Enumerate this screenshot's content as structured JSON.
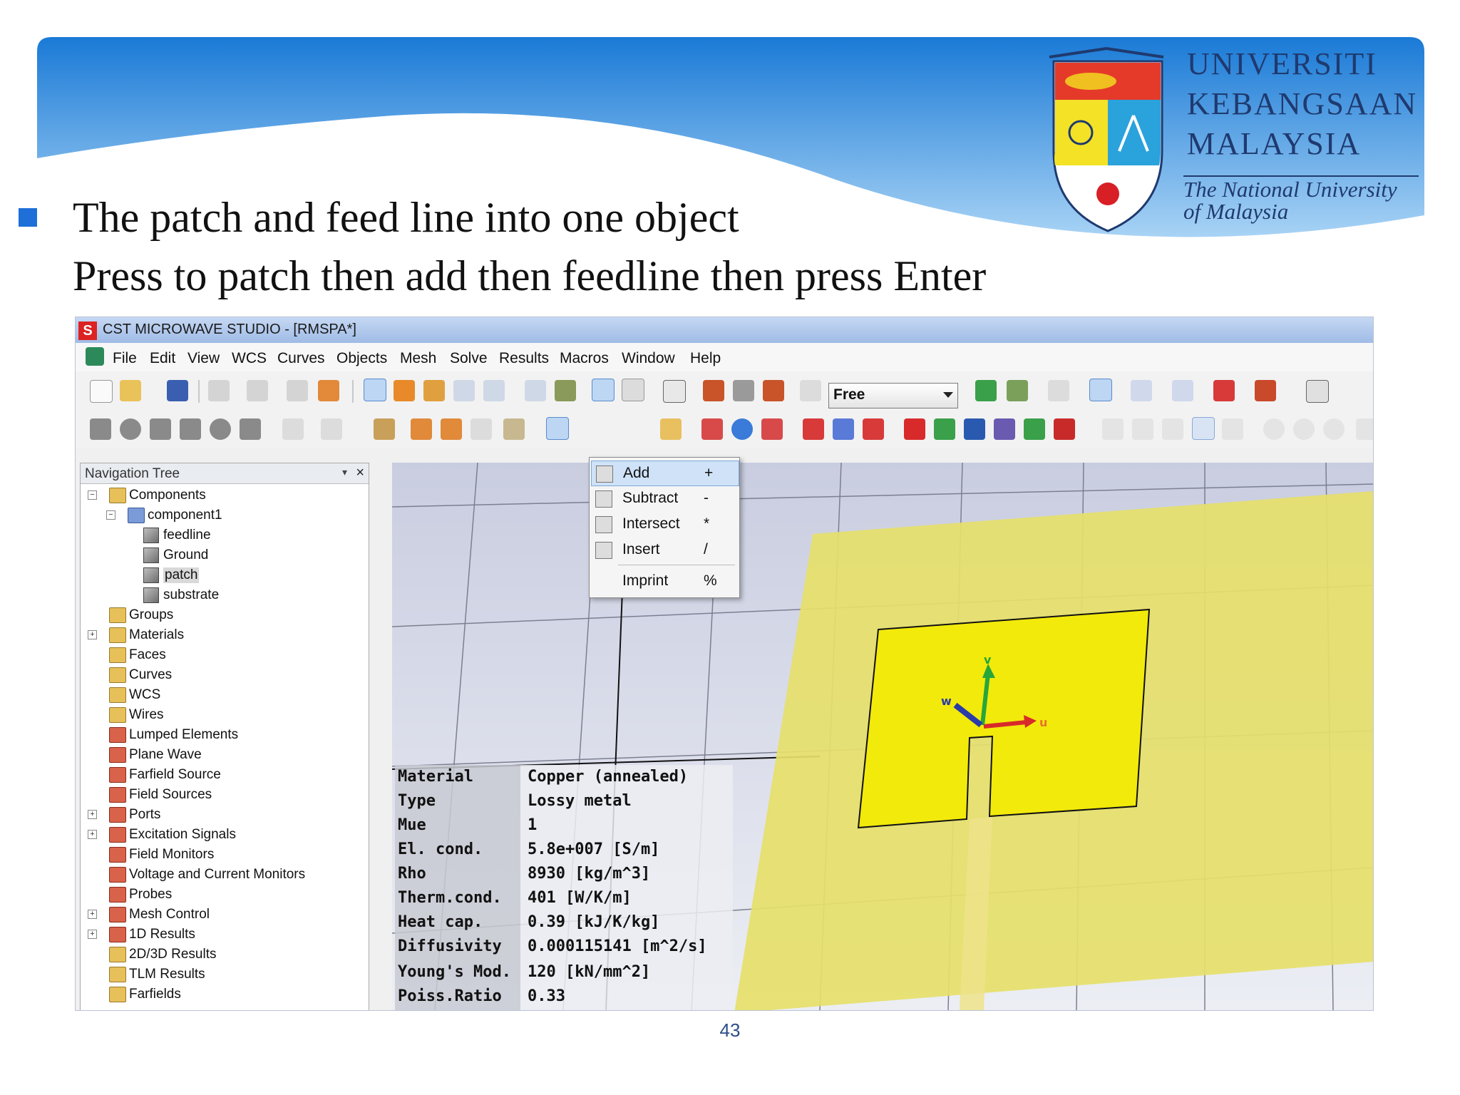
{
  "slide": {
    "line1": "The patch and feed line into one object",
    "line2": "Press to patch then add then feedline then press Enter",
    "page_number": "43"
  },
  "university": {
    "name_line1": "UNIVERSITI",
    "name_line2": "KEBANGSAAN",
    "name_line3": "MALAYSIA",
    "subtitle_line1": "The National University",
    "subtitle_line2": "of Malaysia"
  },
  "app": {
    "title": "CST MICROWAVE STUDIO - [RMSPA*]",
    "menu": [
      "File",
      "Edit",
      "View",
      "WCS",
      "Curves",
      "Objects",
      "Mesh",
      "Solve",
      "Results",
      "Macros",
      "Window",
      "Help"
    ],
    "view_mode": "Free"
  },
  "nav": {
    "title": "Navigation Tree",
    "items": [
      "Components",
      "component1",
      "feedline",
      "Ground",
      "patch",
      "substrate",
      "Groups",
      "Materials",
      "Faces",
      "Curves",
      "WCS",
      "Wires",
      "Lumped Elements",
      "Plane Wave",
      "Farfield Source",
      "Field Sources",
      "Ports",
      "Excitation Signals",
      "Field Monitors",
      "Voltage and Current Monitors",
      "Probes",
      "Mesh Control",
      "1D Results",
      "2D/3D Results",
      "TLM Results",
      "Farfields"
    ]
  },
  "context_menu": {
    "items": [
      {
        "label": "Add",
        "key": "+"
      },
      {
        "label": "Subtract",
        "key": "-"
      },
      {
        "label": "Intersect",
        "key": "*"
      },
      {
        "label": "Insert",
        "key": "/"
      },
      {
        "label": "Imprint",
        "key": "%"
      }
    ]
  },
  "material": {
    "labels": [
      "Material",
      "Type",
      "Mue",
      "El. cond.",
      "Rho",
      "Therm.cond.",
      "Heat cap.",
      "Diffusivity",
      "Young's Mod.",
      "Poiss.Ratio"
    ],
    "values": [
      "Copper (annealed)",
      "Lossy metal",
      "1",
      "5.8e+007 [S/m]",
      "8930 [kg/m^3]",
      "401 [W/K/m]",
      "0.39 [kJ/K/kg]",
      "0.000115141 [m^2/s]",
      "120 [kN/mm^2]",
      "0.33"
    ]
  },
  "axes": {
    "u": "u",
    "v": "v",
    "w": "w"
  }
}
